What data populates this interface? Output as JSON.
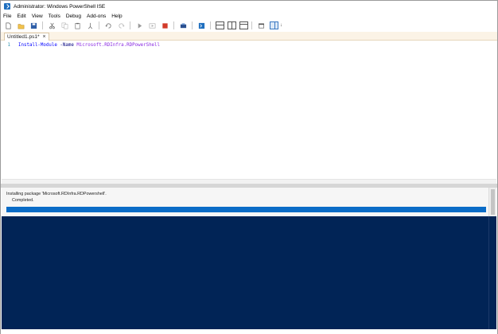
{
  "window": {
    "title": "Administrator: Windows PowerShell ISE"
  },
  "menu": {
    "items": [
      "File",
      "Edit",
      "View",
      "Tools",
      "Debug",
      "Add-ons",
      "Help"
    ]
  },
  "toolbar": {
    "more": "↓"
  },
  "tabs": [
    {
      "label": "Untitled1.ps1*",
      "close": "×"
    }
  ],
  "editor": {
    "lines": [
      {
        "number": "1",
        "command": "Install-Module",
        "parameter": "-Name",
        "argument": "Microsoft.RDInfra.RDPowerShell"
      }
    ]
  },
  "progress": {
    "activity": "Installing package 'Microsoft.RDInfra.RDPowershell'.",
    "status": "Completed.",
    "percent": 100
  },
  "colors": {
    "console_bg": "#012456",
    "progress_fill": "#0a6cc7",
    "keyword": "#0000ff",
    "argument": "#8a2be2",
    "line_number": "#2b91af"
  }
}
